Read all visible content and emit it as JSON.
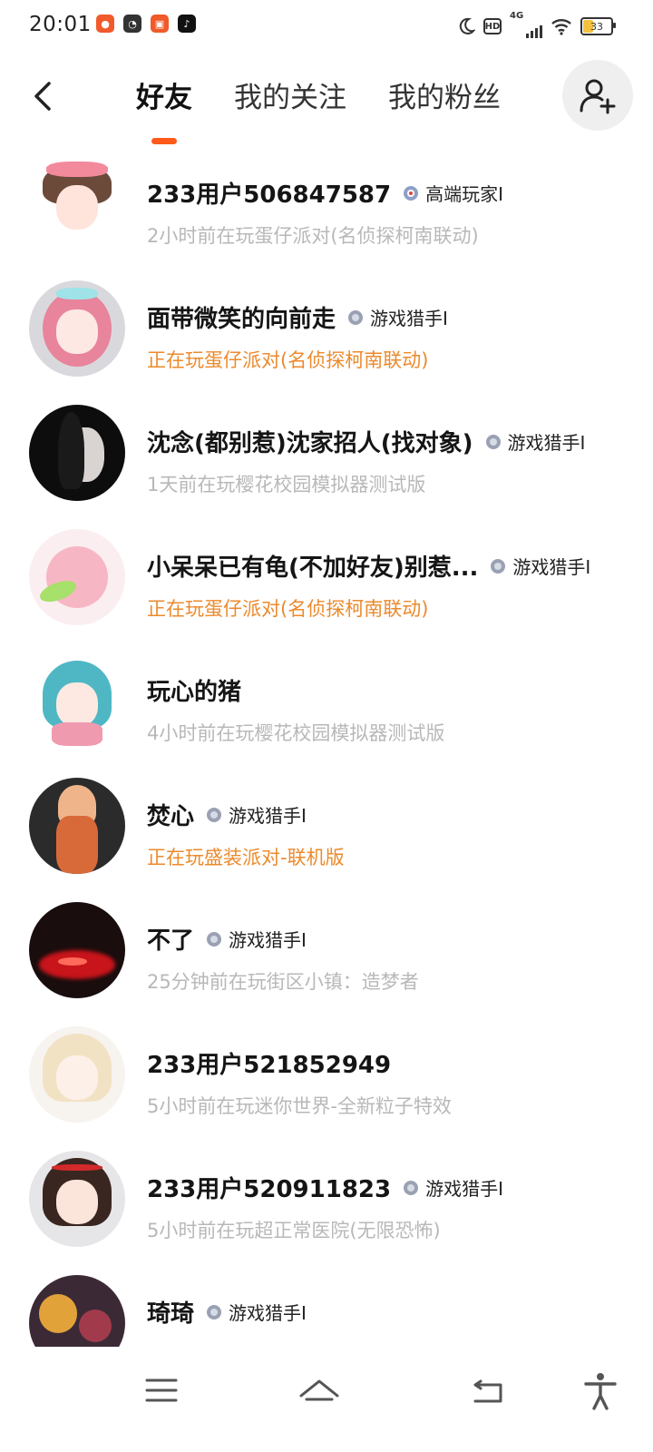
{
  "status_bar": {
    "time": "20:01",
    "apps": [
      {
        "icon": "app-red-icon",
        "color": "#f15a2b"
      },
      {
        "icon": "app-dark-icon",
        "color": "#333333"
      },
      {
        "icon": "app-orange-icon",
        "color": "#f05a28"
      },
      {
        "icon": "tiktok-icon",
        "color": "#111111"
      }
    ],
    "network": "4G",
    "hd": "HD",
    "battery": "33"
  },
  "header": {
    "tabs": [
      {
        "label": "好友",
        "active": true
      },
      {
        "label": "我的关注",
        "active": false
      },
      {
        "label": "我的粉丝",
        "active": false
      }
    ],
    "accent": "#ff5a19"
  },
  "friends": [
    {
      "name": "233用户506847587",
      "badge": "高端玩家Ⅰ",
      "status": "2小时前在玩蛋仔派对(名侦探柯南联动)",
      "playing": false
    },
    {
      "name": "面带微笑的向前走",
      "badge": "游戏猎手Ⅰ",
      "status": "正在玩蛋仔派对(名侦探柯南联动)",
      "playing": true
    },
    {
      "name": "沈念(都别惹)沈家招人(找对象)",
      "badge": "游戏猎手Ⅰ",
      "status": "1天前在玩樱花校园模拟器测试版",
      "playing": false
    },
    {
      "name": "小呆呆已有龟(不加好友)别惹...",
      "badge": "游戏猎手Ⅰ",
      "status": "正在玩蛋仔派对(名侦探柯南联动)",
      "playing": true
    },
    {
      "name": "玩心的猪",
      "badge": "",
      "status": "4小时前在玩樱花校园模拟器测试版",
      "playing": false
    },
    {
      "name": "焚心",
      "badge": "游戏猎手Ⅰ",
      "status": "正在玩盛装派对-联机版",
      "playing": true
    },
    {
      "name": "不了",
      "badge": "游戏猎手Ⅰ",
      "status": "25分钟前在玩街区小镇：造梦者",
      "playing": false
    },
    {
      "name": "233用户521852949",
      "badge": "",
      "status": "5小时前在玩迷你世界-全新粒子特效",
      "playing": false
    },
    {
      "name": "233用户520911823",
      "badge": "游戏猎手Ⅰ",
      "status": "5小时前在玩超正常医院(无限恐怖)",
      "playing": false
    },
    {
      "name": "琦琦",
      "badge": "游戏猎手Ⅰ",
      "status": "",
      "playing": false
    }
  ],
  "colors": {
    "playing_status": "#ec8a2c",
    "idle_status": "#b8b8b8"
  }
}
